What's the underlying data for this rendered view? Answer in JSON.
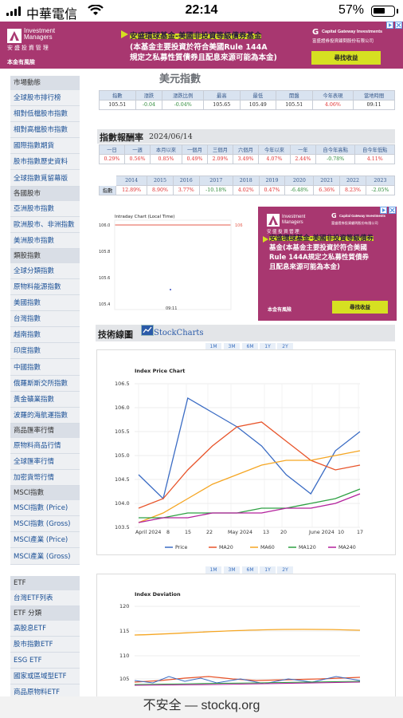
{
  "status_bar": {
    "carrier": "中華電信",
    "time": "22:14",
    "battery": "57%"
  },
  "top_ad": {
    "brand_line1": "Investment",
    "brand_line2": "Managers",
    "brand_cn": "安 盛 投 資 管 理",
    "headline_1": "安盛環球基金-美國非投資等級債券基金",
    "headline_2": "(本基金主要投資於符合美國Rule 144A",
    "headline_3": "規定之私募性質債券且配息來源可能為本金)",
    "partner_1": "Capital Gateway Investments",
    "partner_2": "富盛證券投資顧問股份有限公司",
    "cta": "尋找收益",
    "risk": "本金有風險"
  },
  "page": {
    "title": "美元指數"
  },
  "sidebar": {
    "items": [
      {
        "t": "市場動態",
        "h": true
      },
      {
        "t": "全球股市排行榜"
      },
      {
        "t": "相對低檔股市指數"
      },
      {
        "t": "相對高檔股市指數"
      },
      {
        "t": "國際指數期貨"
      },
      {
        "t": "股市指數歷史資料"
      },
      {
        "t": "全球指數覓留幕版"
      },
      {
        "t": "各國股市",
        "h": true
      },
      {
        "t": "亞洲股市指數"
      },
      {
        "t": "歐洲股市、非洲指數"
      },
      {
        "t": "美洲股市指數"
      },
      {
        "t": "類股指數",
        "h": true
      },
      {
        "t": "全球分類指數"
      },
      {
        "t": "原物料能源指數"
      },
      {
        "t": "美國指數"
      },
      {
        "t": "台灣指數"
      },
      {
        "t": "越南指數"
      },
      {
        "t": "印度指數"
      },
      {
        "t": "中國指數"
      },
      {
        "t": "俄羅斯斯交所指數"
      },
      {
        "t": "黃金礦業指數"
      },
      {
        "t": "波羅的海航運指數"
      },
      {
        "t": "商品匯率行情",
        "h": true
      },
      {
        "t": "原物料商品行情"
      },
      {
        "t": "全球匯率行情"
      },
      {
        "t": "加密貨幣行情"
      },
      {
        "t": "MSCI指數",
        "h": true
      },
      {
        "t": "MSCI指數 (Price)"
      },
      {
        "t": "MSCI指數 (Gross)"
      },
      {
        "t": "MSCI產業 (Price)"
      },
      {
        "t": "MSCI產業 (Gross)"
      },
      {
        "t": "",
        "gap": true
      },
      {
        "t": "ETF",
        "h": true
      },
      {
        "t": "台灣ETF列表"
      },
      {
        "t": "ETF 分類",
        "h": true
      },
      {
        "t": "高股息ETF"
      },
      {
        "t": "股市指數ETF"
      },
      {
        "t": "ESG ETF"
      },
      {
        "t": "國家或區域型ETF"
      },
      {
        "t": "商品原物料ETF"
      }
    ]
  },
  "quote": {
    "headers": [
      "指數",
      "漲跌",
      "漲跌比例",
      "最高",
      "最低",
      "開盤",
      "今年表現",
      "當地時間"
    ],
    "values": [
      "105.51",
      "-0.04",
      "-0.04%",
      "105.65",
      "105.49",
      "105.51",
      "4.06%",
      "09:11"
    ]
  },
  "returns": {
    "title": "指數報酬率",
    "date": "2024/06/14",
    "headers": [
      "一日",
      "一週",
      "本月以來",
      "一個月",
      "三個月",
      "六個月",
      "今年以來",
      "一年",
      "自今年高點",
      "自今年低點"
    ],
    "values": [
      "0.29%",
      "0.56%",
      "0.85%",
      "0.49%",
      "2.09%",
      "3.49%",
      "4.07%",
      "2.44%",
      "-0.78%",
      "4.11%"
    ]
  },
  "yearly": {
    "row_label": "指數",
    "years": [
      "2014",
      "2015",
      "2016",
      "2017",
      "2018",
      "2019",
      "2020",
      "2021",
      "2022",
      "2023"
    ],
    "values": [
      "12.89%",
      "8.90%",
      "3.77%",
      "-10.18%",
      "4.02%",
      "0.47%",
      "-6.48%",
      "6.36%",
      "8.23%",
      "-2.05%"
    ]
  },
  "intraday": {
    "title": "Intraday Chart (Local Time)",
    "yticks": [
      "106.0",
      "105.8",
      "105.6",
      "105.4"
    ],
    "ref_value": "106",
    "xlabel": "09:11"
  },
  "side_ad": {
    "brand_line1": "Investment",
    "brand_line2": "Managers",
    "brand_cn": "安 盛 投 資 管 理",
    "h1": "安盛環球基金-美國非投資等級債券",
    "h2": "基金(本基金主要投資於符合美國",
    "h3": "Rule 144A規定之私募性質債券",
    "h4": "且配息來源可能為本金)",
    "partner_1": "Capital Gateway Investments",
    "partner_2": "富盛證券投資顧問股份有限公司",
    "cta": "尋找收益",
    "risk": "本金有風險"
  },
  "tech": {
    "title": "技術線圖",
    "brand": "StockCharts",
    "ranges": [
      "1M",
      "3M",
      "6M",
      "1Y",
      "2Y"
    ]
  },
  "price_chart": {
    "title": "Index Price Chart",
    "yticks": [
      "106.5",
      "106.0",
      "105.5",
      "105.0",
      "104.5",
      "104.0",
      "103.5"
    ],
    "xticks": [
      "April 2024",
      "8",
      "15",
      "22",
      "May 2024",
      "13",
      "20",
      "June 2024",
      "10",
      "17"
    ],
    "legend": [
      "Price",
      "MA20",
      "MA60",
      "MA120",
      "MA240"
    ]
  },
  "dev_chart": {
    "title": "Index Deviation",
    "yticks": [
      "120",
      "115",
      "110",
      "105"
    ]
  },
  "chart_data": {
    "type": "line",
    "title": "Index Price Chart",
    "ylim": [
      103.5,
      106.5
    ],
    "x": [
      "Apr 1",
      "Apr 8",
      "Apr 15",
      "Apr 22",
      "May 1",
      "May 13",
      "May 20",
      "Jun 3",
      "Jun 10",
      "Jun 17"
    ],
    "series": [
      {
        "name": "Price",
        "values": [
          104.6,
          104.1,
          106.2,
          105.9,
          105.6,
          105.2,
          104.6,
          104.2,
          105.1,
          105.5
        ]
      },
      {
        "name": "MA20",
        "values": [
          103.9,
          104.1,
          104.7,
          105.2,
          105.6,
          105.7,
          105.3,
          104.9,
          104.7,
          104.8
        ]
      },
      {
        "name": "MA60",
        "values": [
          103.6,
          103.8,
          104.1,
          104.4,
          104.6,
          104.8,
          104.9,
          104.9,
          105.0,
          105.1
        ]
      },
      {
        "name": "MA120",
        "values": [
          103.7,
          103.7,
          103.8,
          103.8,
          103.8,
          103.9,
          103.9,
          104.0,
          104.1,
          104.3
        ]
      },
      {
        "name": "MA240",
        "values": [
          103.6,
          103.7,
          103.7,
          103.8,
          103.8,
          103.8,
          103.9,
          103.9,
          104.0,
          104.2
        ]
      }
    ],
    "colors": {
      "Price": "#3b6cc4",
      "MA20": "#e8542a",
      "MA60": "#f5a623",
      "MA120": "#2ea043",
      "MA240": "#b3209c"
    }
  },
  "url_bar": {
    "text": "不安全 — stockq.org"
  }
}
